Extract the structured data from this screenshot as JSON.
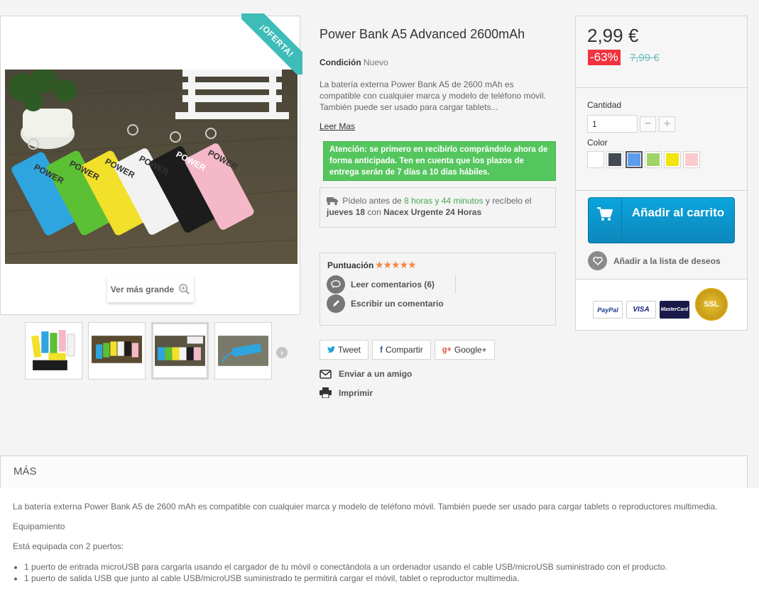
{
  "product": {
    "title": "Power Bank A5 Advanced 2600mAh",
    "ribbon": "¡OFERTA!",
    "zoom_label": "Ver más grande",
    "condition_label": "Condición",
    "condition_value": "Nuevo",
    "short_description": "La batería externa Power Bank A5 de 2600 mAh es compatible con cualquier marca y modelo de teléfono móvil. También puede ser usado para cargar tablets...",
    "read_more": "Leer Mas",
    "alert": "Atención: se primero en recibirlo comprándolo ahora de forma anticipada. Ten en cuenta que los plazos de entrega serán de 7 días a 10 días hábiles.",
    "photo_brand_text": "POWER"
  },
  "delivery": {
    "part1": "Pídelo antes de",
    "time_hours": "8 horas",
    "and": "y",
    "time_minutes": "44 minutos",
    "part2": "y recíbelo el",
    "day": "jueves 18",
    "with": "con",
    "carrier": "Nacex Urgente 24 Horas"
  },
  "rating": {
    "label": "Puntuación",
    "stars": "★★★★★",
    "read_reviews": "Leer comentarios (6)",
    "write_review": "Escribir un comentario"
  },
  "share": {
    "tweet": "Tweet",
    "facebook": "Compartir",
    "google": "Google+",
    "send_friend": "Enviar a un amigo",
    "print": "Imprimir"
  },
  "buy": {
    "price": "2,99 €",
    "discount": "-63%",
    "old_price": "7,99 €",
    "quantity_label": "Cantidad",
    "quantity_value": "1",
    "minus": "−",
    "plus": "+",
    "color_label": "Color",
    "colors": [
      "#ffffff",
      "#434a54",
      "#5d9cec",
      "#a0d468",
      "#f1e40f",
      "#fccacd"
    ],
    "selected_color_index": 2,
    "add_to_cart": "Añadir al carrito",
    "wishlist": "Añadir a la lista de deseos",
    "payment_logos": [
      "PayPal",
      "VISA",
      "MasterCard",
      "SSL"
    ]
  },
  "more": {
    "heading": "Más",
    "paragraph1": "La batería externa Power Bank A5 de 2600 mAh es compatible con cualquier marca y modelo de teléfono móvil. También puede ser usado para cargar tablets o reproductores multimedia.",
    "paragraph2": "Equipamiento",
    "paragraph3": "Está equipada con 2 puertos:",
    "list": [
      "1 puerto de entrada microUSB para cargarla usando el cargador de tu móvil o conectándola a un ordenador usando el cable USB/microUSB suministrado con el producto.",
      "1 puerto de salida USB que junto al cable USB/microUSB suministrado te permitirá cargar el móvil, tablet o reproductor multimedia."
    ]
  }
}
